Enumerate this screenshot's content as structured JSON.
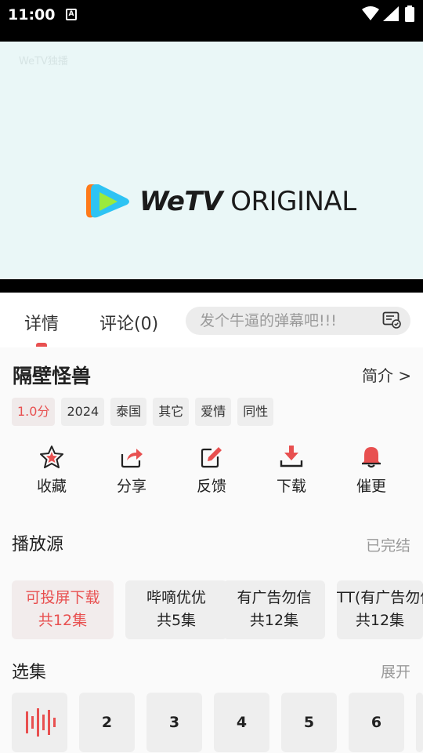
{
  "status_bar": {
    "time": "11:00",
    "notification_letter": "A"
  },
  "video": {
    "watermark": "WeTV独播",
    "logo_we": "WeTV",
    "logo_rest": " ORIGINAL"
  },
  "tabs": {
    "details": "详情",
    "comments": "评论(0)"
  },
  "danmu": {
    "placeholder": "发个牛逼的弹幕吧!!!"
  },
  "show": {
    "title": "隔壁怪兽",
    "intro_link": "简介 >",
    "tags": [
      "1.0分",
      "2024",
      "泰国",
      "其它",
      "爱情",
      "同性"
    ]
  },
  "actions": [
    "收藏",
    "分享",
    "反馈",
    "下载",
    "催更"
  ],
  "sources": {
    "title": "播放源",
    "status": "已完结",
    "items": [
      {
        "name": "可投屏下载",
        "count": "共12集"
      },
      {
        "name": "哔嘀优优",
        "count": "共5集"
      },
      {
        "name": "有广告勿信",
        "count": "共12集"
      },
      {
        "name": "TT(有广告勿信)",
        "count": "共12集"
      }
    ]
  },
  "episodes": {
    "title": "选集",
    "expand": "展开",
    "items": [
      "2",
      "3",
      "4",
      "5",
      "6"
    ]
  },
  "colors": {
    "accent": "#e85050",
    "chip_bg": "#eeeeee",
    "black_bar": "#000000",
    "video_bg": "#eaf7f7"
  }
}
